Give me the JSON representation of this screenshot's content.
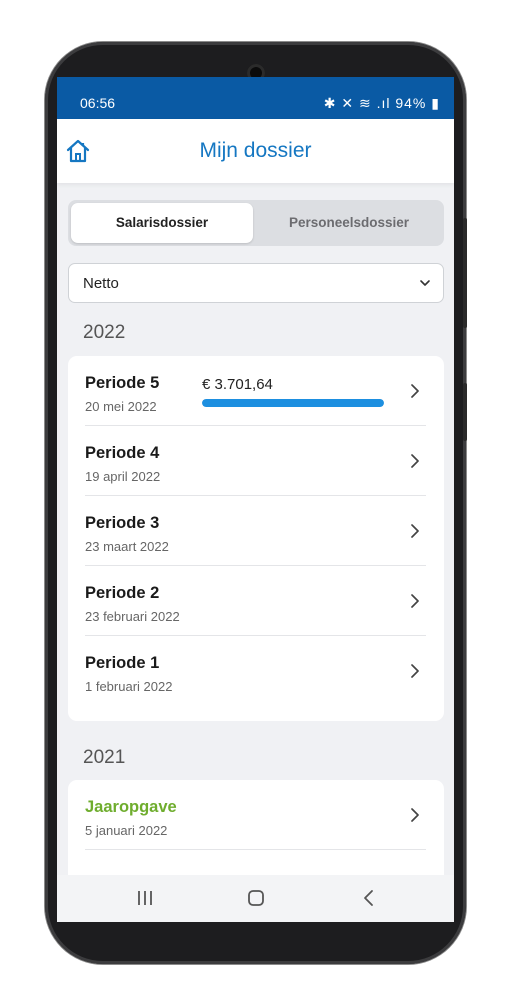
{
  "status": {
    "time": "06:56",
    "icons_text": "✱ 🔇 ≋ .ıl 94%▮",
    "battery": "94%"
  },
  "header": {
    "title": "Mijn dossier"
  },
  "tabs": {
    "salaris": "Salarisdossier",
    "personeel": "Personeelsdossier"
  },
  "filter": {
    "selected": "Netto"
  },
  "sections": [
    {
      "year": "2022",
      "rows": [
        {
          "title": "Periode 5",
          "date": "20 mei 2022",
          "amount": "€ 3.701,64",
          "progress_percent": 100
        },
        {
          "title": "Periode 4",
          "date": "19 april 2022"
        },
        {
          "title": "Periode 3",
          "date": "23 maart 2022"
        },
        {
          "title": "Periode 2",
          "date": "23 februari 2022"
        },
        {
          "title": "Periode 1",
          "date": "1 februari 2022"
        }
      ]
    },
    {
      "year": "2021",
      "rows": [
        {
          "title": "Jaaropgave",
          "date": "5 januari 2022"
        }
      ]
    }
  ],
  "colors": {
    "primary": "#1577c2",
    "statusbar": "#0a5aa4",
    "accent_green": "#6fad2e",
    "progress": "#1d8fe0"
  }
}
